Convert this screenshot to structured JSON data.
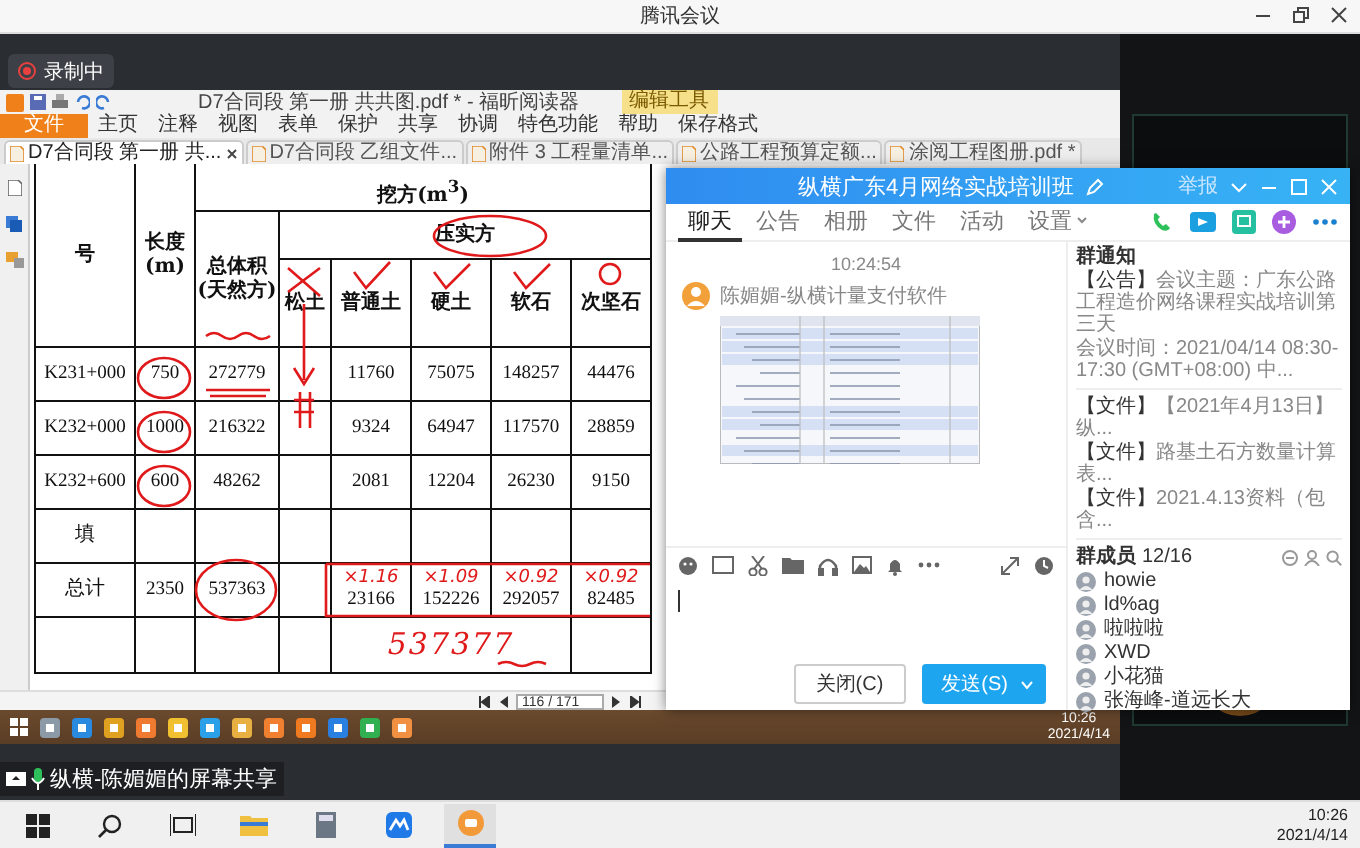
{
  "window": {
    "title": "腾讯会议"
  },
  "recording": {
    "label": "录制中"
  },
  "reader": {
    "app_title": "D7合同段 第一册 共共图.pdf * - 福昕阅读器",
    "tool_tab": "编辑工具",
    "ribbon": [
      {
        "label": "文件",
        "selected": true
      },
      {
        "label": "主页",
        "selected": false
      },
      {
        "label": "注释",
        "selected": false
      },
      {
        "label": "视图",
        "selected": false
      },
      {
        "label": "表单",
        "selected": false
      },
      {
        "label": "保护",
        "selected": false
      },
      {
        "label": "共享",
        "selected": false
      },
      {
        "label": "协调",
        "selected": false
      },
      {
        "label": "特色功能",
        "selected": false
      },
      {
        "label": "帮助",
        "selected": false
      },
      {
        "label": "保存格式",
        "selected": false
      }
    ],
    "doc_tabs": [
      {
        "label": "D7合同段 第一册 共...",
        "selected": true
      },
      {
        "label": "D7合同段 乙组文件...",
        "selected": false
      },
      {
        "label": "附件 3 工程量清单...",
        "selected": false
      },
      {
        "label": "公路工程预算定额...",
        "selected": false
      },
      {
        "label": "涂阅工程图册.pdf *",
        "selected": false
      }
    ],
    "table": {
      "group_header": "挖方(m$^{3}$)",
      "sub_header": "压实方",
      "columns": [
        "号",
        "长度\n(m)",
        "总体积\n(天然方)",
        "松土",
        "普通土",
        "硬土",
        "软石",
        "次坚石"
      ],
      "rows": [
        {
          "cells": [
            "K231+000",
            "750",
            "272779",
            "",
            "11760",
            "75075",
            "148257",
            "44476"
          ]
        },
        {
          "cells": [
            "K232+000",
            "1000",
            "216322",
            "",
            "9324",
            "64947",
            "117570",
            "28859"
          ]
        },
        {
          "cells": [
            "K232+600",
            "600",
            "48262",
            "",
            "2081",
            "12204",
            "26230",
            "9150"
          ]
        },
        {
          "cells": [
            "填",
            "",
            "",
            "",
            "",
            "",
            "",
            ""
          ]
        },
        {
          "cells": [
            "总计",
            "2350",
            "537363",
            "",
            "23166",
            "152226",
            "292057",
            "82485"
          ]
        }
      ],
      "ink_multipliers": [
        "×1.16",
        "×1.09",
        "×0.92",
        "×0.92"
      ],
      "ink_total": "537377"
    },
    "page_indicator": "116 / 171"
  },
  "shared_taskbar": {
    "time": "10:26",
    "date": "2021/4/14"
  },
  "chat": {
    "title": "纵横广东4月网络实战培训班",
    "report": "举报",
    "tabs": [
      {
        "label": "聊天",
        "selected": true
      },
      {
        "label": "公告",
        "selected": false
      },
      {
        "label": "相册",
        "selected": false
      },
      {
        "label": "文件",
        "selected": false
      },
      {
        "label": "活动",
        "selected": false
      },
      {
        "label": "设置",
        "selected": false
      }
    ],
    "message": {
      "time": "10:24:54",
      "sender": "陈媚媚-纵横计量支付软件"
    },
    "buttons": {
      "close": "关闭(C)",
      "send": "发送(S)"
    },
    "notice": {
      "title": "群通知",
      "label": "【公告】",
      "text": "会议主题：广东公路工程造价网络课程实战培训第三天",
      "time": "会议时间：2021/04/14 08:30-17:30 (GMT+08:00) 中..."
    },
    "files": [
      {
        "label": "【文件】",
        "text": "【2021年4月13日】纵..."
      },
      {
        "label": "【文件】",
        "text": "路基土石方数量计算表..."
      },
      {
        "label": "【文件】",
        "text": "2021.4.13资料（包含..."
      }
    ],
    "members_title": "群成员",
    "members_count": "12/16",
    "members": [
      "howie",
      "ld%ag",
      "啦啦啦",
      "XWD",
      "小花猫",
      "张海峰-道远长大"
    ]
  },
  "share_label": "纵横-陈媚媚的屏幕共享",
  "taskbar": {
    "time": "10:26",
    "date": "2021/4/14"
  }
}
